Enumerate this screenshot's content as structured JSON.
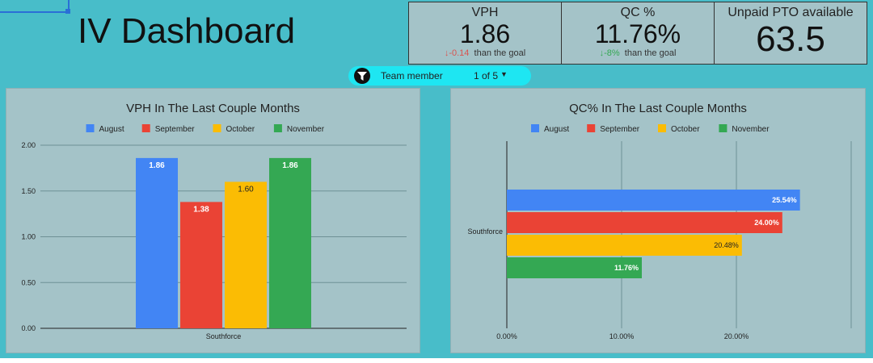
{
  "dashboard": {
    "title": "IV Dashboard"
  },
  "kpis": {
    "vph": {
      "label": "VPH",
      "value": "1.86",
      "delta": "-0.14",
      "delta_text": "than the goal"
    },
    "qc": {
      "label": "QC %",
      "value": "11.76%",
      "delta": "-8%",
      "delta_text": "than the goal"
    },
    "pto": {
      "label": "Unpaid PTO available",
      "value": "63.5"
    }
  },
  "filter": {
    "label": "Team member",
    "value": "1 of 5"
  },
  "colors": {
    "background": "#48bdc9",
    "panel": "#a4c3c8",
    "august": "#4285f4",
    "september": "#ea4335",
    "october": "#fbbc04",
    "november": "#34a853"
  },
  "chart_data": [
    {
      "type": "bar",
      "title": "VPH In The Last Couple Months",
      "categories": [
        "Southforce"
      ],
      "series": [
        {
          "name": "August",
          "values": [
            1.86
          ]
        },
        {
          "name": "September",
          "values": [
            1.38
          ]
        },
        {
          "name": "October",
          "values": [
            1.6
          ]
        },
        {
          "name": "November",
          "values": [
            1.86
          ]
        }
      ],
      "data_labels": [
        "1.86",
        "1.38",
        "1.60",
        "1.86"
      ],
      "ylim": [
        0,
        2.0
      ],
      "yticks": [
        "0.00",
        "0.50",
        "1.00",
        "1.50",
        "2.00"
      ],
      "grid": true,
      "legend": "top"
    },
    {
      "type": "bar",
      "orientation": "horizontal",
      "title": "QC% In The Last Couple Months",
      "categories": [
        "Southforce"
      ],
      "series": [
        {
          "name": "August",
          "values": [
            25.54
          ]
        },
        {
          "name": "September",
          "values": [
            24.0
          ]
        },
        {
          "name": "October",
          "values": [
            20.48
          ]
        },
        {
          "name": "November",
          "values": [
            11.76
          ]
        }
      ],
      "data_labels": [
        "25.54%",
        "24.00%",
        "20.48%",
        "11.76%"
      ],
      "xlim": [
        0,
        30
      ],
      "xticks": [
        "0.00%",
        "10.00%",
        "20.00%"
      ],
      "grid": true,
      "legend": "top"
    }
  ]
}
